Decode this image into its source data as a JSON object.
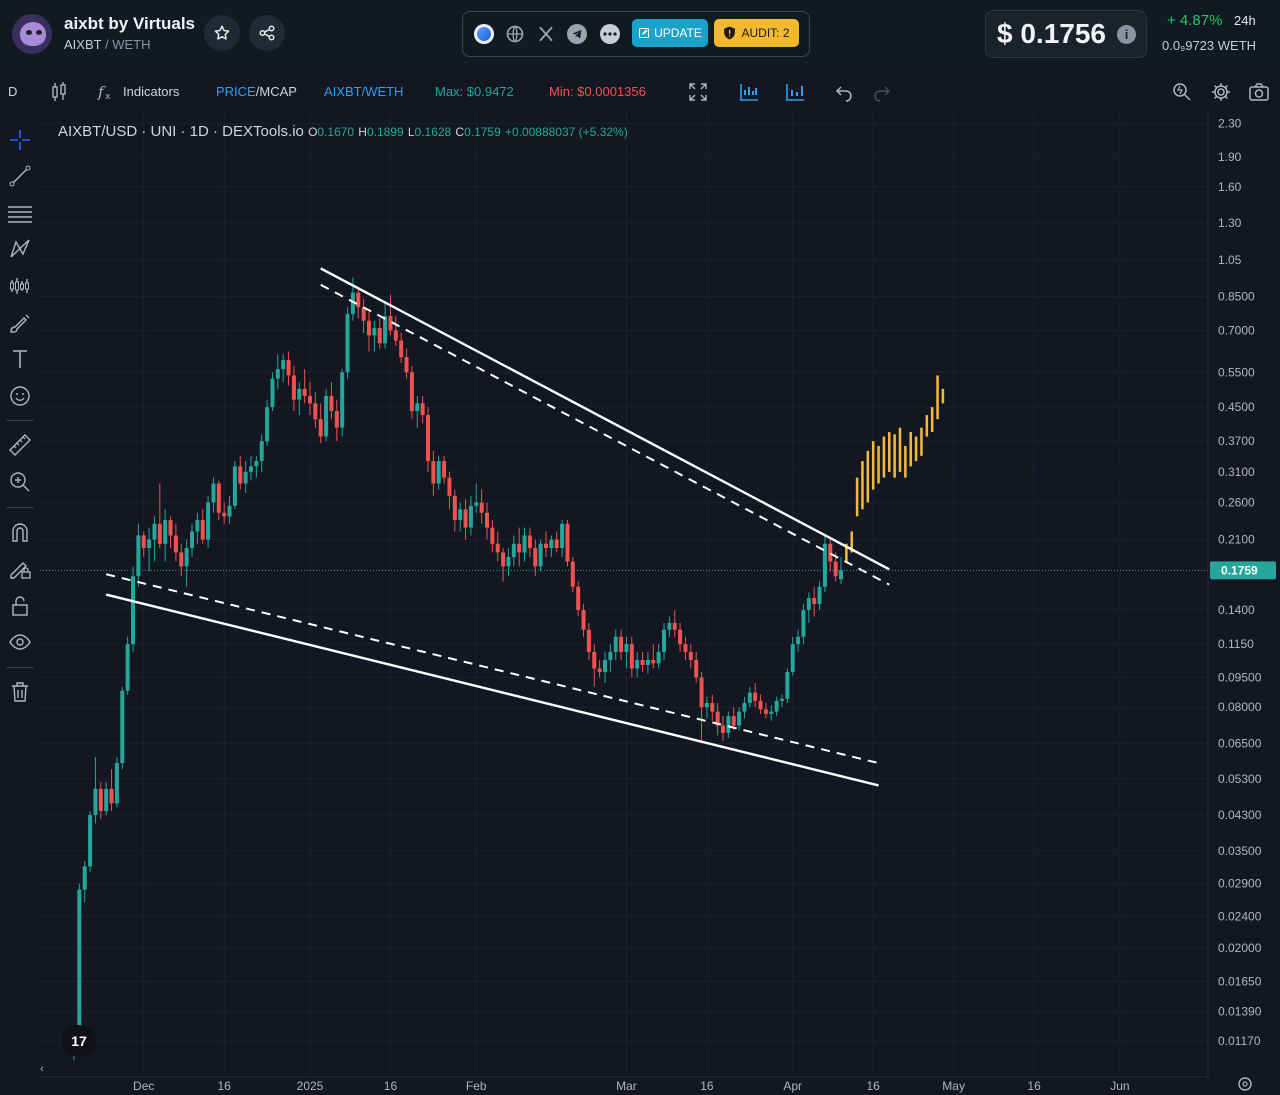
{
  "header": {
    "token_name": "aixbt by Virtuals",
    "token_symbol": "AIXBT",
    "quote_separator": "/",
    "quote_symbol": "WETH",
    "update_label": "UPDATE",
    "audit_label": "AUDIT: 2",
    "price_value": "$ 0.1756",
    "info_label": "i",
    "change": "+ 4.87%",
    "period": "24h",
    "weth_price": "0.0₉9723  WETH"
  },
  "social_icons": [
    "tokenomics-icon",
    "website-icon",
    "x-twitter-icon",
    "telegram-icon",
    "more-icon"
  ],
  "toolbar": {
    "interval": "D",
    "indicators_label": "Indicators",
    "price_label": "PRICE",
    "separator": "/",
    "mcap_label": "MCAP",
    "pair_label": "AIXBT/WETH",
    "max_label": "Max: $0.9472",
    "min_label": "Min: $0.0001356"
  },
  "legend": {
    "symbol": "AIXBT/USD · UNI · 1D · DEXTools.io",
    "o": "0.1670",
    "h": "0.1899",
    "l": "0.1628",
    "c": "0.1759",
    "change": "+0.00888037 (+5.32%)"
  },
  "left_tools": [
    "crosshair-icon",
    "trend-line-icon",
    "fib-icon",
    "pattern-icon",
    "prediction-icon",
    "brush-icon",
    "text-icon",
    "emoji-icon",
    "ruler-icon",
    "zoom-icon",
    "magnet-icon",
    "lock-draw-icon",
    "lock-icon",
    "eye-icon",
    "trash-icon"
  ],
  "colors": {
    "background": "#131722",
    "up": "#26a69a",
    "down": "#ef5350",
    "projection": "#f5b93b",
    "trendline": "#ffffff",
    "current_price_tag": "#26a69a",
    "accent": "#2962ff"
  },
  "chart_data": {
    "type": "candlestick",
    "title": "AIXBT/USD · UNI · 1D · DEXTools.io",
    "y_scale": "log",
    "ylim": [
      0.0105,
      2.35
    ],
    "y_ticks": [
      2.3,
      1.9,
      1.6,
      1.3,
      1.05,
      0.85,
      0.7,
      0.55,
      0.45,
      0.37,
      0.31,
      0.26,
      0.21,
      0.14,
      0.115,
      0.095,
      0.08,
      0.065,
      0.053,
      0.043,
      0.035,
      0.029,
      0.024,
      0.02,
      0.0165,
      0.0139,
      0.0117
    ],
    "y_tick_labels": [
      "2.30",
      "1.90",
      "1.60",
      "1.30",
      "1.05",
      "0.8500",
      "0.7000",
      "0.5500",
      "0.4500",
      "0.3700",
      "0.3100",
      "0.2600",
      "0.2100",
      "0.1400",
      "0.1150",
      "0.09500",
      "0.08000",
      "0.06500",
      "0.05300",
      "0.04300",
      "0.03500",
      "0.02900",
      "0.02400",
      "0.02000",
      "0.01650",
      "0.01390",
      "0.01170"
    ],
    "x_ticks": [
      "Dec",
      "16",
      "2025",
      "16",
      "Feb",
      "Mar",
      "16",
      "Apr",
      "16",
      "May",
      "16",
      "Jun"
    ],
    "x_tick_days": [
      0,
      15,
      31,
      46,
      62,
      90,
      105,
      121,
      136,
      151,
      166,
      182
    ],
    "x_range_days": [
      -13,
      185
    ],
    "current_price": 0.1759,
    "current_price_label": "0.1759",
    "candles": [
      [
        -13,
        0.011,
        0.0125,
        0.0105,
        0.0122
      ],
      [
        -12,
        0.0122,
        0.029,
        0.012,
        0.028
      ],
      [
        -11,
        0.028,
        0.033,
        0.026,
        0.032
      ],
      [
        -10,
        0.032,
        0.044,
        0.031,
        0.043
      ],
      [
        -9,
        0.043,
        0.06,
        0.041,
        0.05
      ],
      [
        -8,
        0.05,
        0.052,
        0.042,
        0.044
      ],
      [
        -7,
        0.044,
        0.052,
        0.043,
        0.05
      ],
      [
        -6,
        0.05,
        0.056,
        0.044,
        0.046
      ],
      [
        -5,
        0.046,
        0.06,
        0.045,
        0.058
      ],
      [
        -4,
        0.058,
        0.09,
        0.056,
        0.088
      ],
      [
        -3,
        0.088,
        0.12,
        0.086,
        0.115
      ],
      [
        -2,
        0.115,
        0.18,
        0.11,
        0.17
      ],
      [
        -1,
        0.17,
        0.23,
        0.16,
        0.215
      ],
      [
        0,
        0.215,
        0.22,
        0.19,
        0.2
      ],
      [
        1,
        0.2,
        0.225,
        0.175,
        0.21
      ],
      [
        2,
        0.21,
        0.24,
        0.185,
        0.23
      ],
      [
        3,
        0.23,
        0.29,
        0.2,
        0.205
      ],
      [
        4,
        0.205,
        0.25,
        0.185,
        0.235
      ],
      [
        5,
        0.235,
        0.24,
        0.2,
        0.215
      ],
      [
        6,
        0.215,
        0.23,
        0.185,
        0.195
      ],
      [
        7,
        0.195,
        0.205,
        0.17,
        0.18
      ],
      [
        8,
        0.18,
        0.21,
        0.16,
        0.2
      ],
      [
        9,
        0.2,
        0.23,
        0.19,
        0.22
      ],
      [
        10,
        0.22,
        0.245,
        0.205,
        0.235
      ],
      [
        11,
        0.235,
        0.25,
        0.205,
        0.21
      ],
      [
        12,
        0.21,
        0.27,
        0.2,
        0.26
      ],
      [
        13,
        0.26,
        0.3,
        0.245,
        0.29
      ],
      [
        14,
        0.29,
        0.295,
        0.235,
        0.245
      ],
      [
        15,
        0.245,
        0.26,
        0.23,
        0.24
      ],
      [
        16,
        0.24,
        0.27,
        0.23,
        0.255
      ],
      [
        17,
        0.255,
        0.33,
        0.25,
        0.32
      ],
      [
        18,
        0.32,
        0.34,
        0.28,
        0.29
      ],
      [
        19,
        0.29,
        0.33,
        0.275,
        0.31
      ],
      [
        20,
        0.31,
        0.34,
        0.295,
        0.32
      ],
      [
        21,
        0.32,
        0.34,
        0.3,
        0.33
      ],
      [
        22,
        0.33,
        0.385,
        0.31,
        0.37
      ],
      [
        23,
        0.37,
        0.47,
        0.36,
        0.45
      ],
      [
        24,
        0.45,
        0.55,
        0.44,
        0.53
      ],
      [
        25,
        0.53,
        0.61,
        0.5,
        0.56
      ],
      [
        26,
        0.56,
        0.61,
        0.52,
        0.59
      ],
      [
        27,
        0.59,
        0.62,
        0.51,
        0.54
      ],
      [
        28,
        0.54,
        0.57,
        0.44,
        0.47
      ],
      [
        29,
        0.47,
        0.52,
        0.43,
        0.5
      ],
      [
        30,
        0.5,
        0.56,
        0.46,
        0.48
      ],
      [
        31,
        0.48,
        0.52,
        0.43,
        0.46
      ],
      [
        32,
        0.46,
        0.49,
        0.4,
        0.42
      ],
      [
        33,
        0.42,
        0.46,
        0.365,
        0.38
      ],
      [
        34,
        0.38,
        0.5,
        0.37,
        0.48
      ],
      [
        35,
        0.48,
        0.52,
        0.42,
        0.44
      ],
      [
        36,
        0.44,
        0.47,
        0.37,
        0.4
      ],
      [
        37,
        0.4,
        0.56,
        0.38,
        0.55
      ],
      [
        38,
        0.55,
        0.8,
        0.53,
        0.77
      ],
      [
        39,
        0.77,
        0.95,
        0.74,
        0.87
      ],
      [
        40,
        0.87,
        0.89,
        0.75,
        0.8
      ],
      [
        41,
        0.8,
        0.84,
        0.69,
        0.74
      ],
      [
        42,
        0.74,
        0.78,
        0.62,
        0.68
      ],
      [
        43,
        0.68,
        0.74,
        0.62,
        0.71
      ],
      [
        44,
        0.71,
        0.75,
        0.63,
        0.65
      ],
      [
        45,
        0.65,
        0.82,
        0.63,
        0.76
      ],
      [
        46,
        0.76,
        0.86,
        0.68,
        0.7
      ],
      [
        47,
        0.7,
        0.76,
        0.64,
        0.66
      ],
      [
        48,
        0.66,
        0.69,
        0.58,
        0.6
      ],
      [
        49,
        0.6,
        0.63,
        0.53,
        0.55
      ],
      [
        50,
        0.55,
        0.57,
        0.42,
        0.44
      ],
      [
        51,
        0.44,
        0.48,
        0.4,
        0.46
      ],
      [
        52,
        0.46,
        0.48,
        0.41,
        0.43
      ],
      [
        53,
        0.43,
        0.45,
        0.31,
        0.33
      ],
      [
        54,
        0.33,
        0.35,
        0.27,
        0.29
      ],
      [
        55,
        0.29,
        0.34,
        0.28,
        0.33
      ],
      [
        56,
        0.33,
        0.34,
        0.29,
        0.3
      ],
      [
        57,
        0.3,
        0.31,
        0.25,
        0.27
      ],
      [
        58,
        0.27,
        0.28,
        0.22,
        0.235
      ],
      [
        59,
        0.235,
        0.26,
        0.22,
        0.25
      ],
      [
        60,
        0.25,
        0.265,
        0.21,
        0.225
      ],
      [
        61,
        0.225,
        0.27,
        0.215,
        0.255
      ],
      [
        62,
        0.255,
        0.29,
        0.245,
        0.26
      ],
      [
        63,
        0.26,
        0.28,
        0.23,
        0.245
      ],
      [
        64,
        0.245,
        0.26,
        0.21,
        0.225
      ],
      [
        65,
        0.225,
        0.235,
        0.195,
        0.205
      ],
      [
        66,
        0.205,
        0.22,
        0.185,
        0.195
      ],
      [
        67,
        0.195,
        0.2,
        0.165,
        0.18
      ],
      [
        68,
        0.18,
        0.2,
        0.17,
        0.19
      ],
      [
        69,
        0.19,
        0.215,
        0.18,
        0.205
      ],
      [
        70,
        0.205,
        0.225,
        0.18,
        0.195
      ],
      [
        71,
        0.195,
        0.225,
        0.185,
        0.215
      ],
      [
        72,
        0.215,
        0.225,
        0.19,
        0.2
      ],
      [
        73,
        0.2,
        0.21,
        0.17,
        0.18
      ],
      [
        74,
        0.18,
        0.21,
        0.175,
        0.205
      ],
      [
        75,
        0.205,
        0.22,
        0.19,
        0.2
      ],
      [
        76,
        0.2,
        0.215,
        0.19,
        0.21
      ],
      [
        77,
        0.21,
        0.22,
        0.195,
        0.2
      ],
      [
        78,
        0.2,
        0.235,
        0.19,
        0.23
      ],
      [
        79,
        0.23,
        0.235,
        0.18,
        0.185
      ],
      [
        80,
        0.185,
        0.19,
        0.155,
        0.16
      ],
      [
        81,
        0.16,
        0.165,
        0.135,
        0.14
      ],
      [
        82,
        0.14,
        0.145,
        0.12,
        0.125
      ],
      [
        83,
        0.125,
        0.13,
        0.105,
        0.11
      ],
      [
        84,
        0.11,
        0.115,
        0.09,
        0.1
      ],
      [
        85,
        0.1,
        0.105,
        0.095,
        0.098
      ],
      [
        86,
        0.098,
        0.11,
        0.092,
        0.105
      ],
      [
        87,
        0.105,
        0.115,
        0.098,
        0.11
      ],
      [
        88,
        0.11,
        0.125,
        0.105,
        0.12
      ],
      [
        89,
        0.12,
        0.125,
        0.105,
        0.11
      ],
      [
        90,
        0.11,
        0.12,
        0.1,
        0.115
      ],
      [
        91,
        0.115,
        0.12,
        0.095,
        0.1
      ],
      [
        92,
        0.1,
        0.11,
        0.095,
        0.105
      ],
      [
        93,
        0.105,
        0.11,
        0.098,
        0.102
      ],
      [
        94,
        0.102,
        0.11,
        0.097,
        0.105
      ],
      [
        95,
        0.105,
        0.115,
        0.1,
        0.103
      ],
      [
        96,
        0.103,
        0.115,
        0.1,
        0.11
      ],
      [
        97,
        0.11,
        0.13,
        0.105,
        0.125
      ],
      [
        98,
        0.125,
        0.135,
        0.12,
        0.13
      ],
      [
        99,
        0.13,
        0.14,
        0.12,
        0.125
      ],
      [
        100,
        0.125,
        0.13,
        0.11,
        0.115
      ],
      [
        101,
        0.115,
        0.12,
        0.105,
        0.11
      ],
      [
        102,
        0.11,
        0.115,
        0.1,
        0.105
      ],
      [
        103,
        0.105,
        0.11,
        0.092,
        0.095
      ],
      [
        104,
        0.095,
        0.098,
        0.065,
        0.08
      ],
      [
        105,
        0.08,
        0.085,
        0.075,
        0.082
      ],
      [
        106,
        0.082,
        0.086,
        0.074,
        0.078
      ],
      [
        107,
        0.078,
        0.082,
        0.068,
        0.072
      ],
      [
        108,
        0.072,
        0.076,
        0.066,
        0.069
      ],
      [
        109,
        0.069,
        0.078,
        0.067,
        0.076
      ],
      [
        110,
        0.076,
        0.08,
        0.07,
        0.072
      ],
      [
        111,
        0.072,
        0.08,
        0.07,
        0.078
      ],
      [
        112,
        0.078,
        0.085,
        0.075,
        0.082
      ],
      [
        113,
        0.082,
        0.09,
        0.08,
        0.087
      ],
      [
        114,
        0.087,
        0.092,
        0.08,
        0.083
      ],
      [
        115,
        0.083,
        0.086,
        0.077,
        0.079
      ],
      [
        116,
        0.079,
        0.082,
        0.075,
        0.077
      ],
      [
        117,
        0.077,
        0.081,
        0.074,
        0.078
      ],
      [
        118,
        0.078,
        0.085,
        0.076,
        0.083
      ],
      [
        119,
        0.083,
        0.086,
        0.08,
        0.084
      ],
      [
        120,
        0.084,
        0.1,
        0.082,
        0.098
      ],
      [
        121,
        0.098,
        0.12,
        0.096,
        0.115
      ],
      [
        122,
        0.115,
        0.125,
        0.11,
        0.12
      ],
      [
        123,
        0.12,
        0.145,
        0.115,
        0.14
      ],
      [
        124,
        0.14,
        0.155,
        0.13,
        0.15
      ],
      [
        125,
        0.15,
        0.16,
        0.135,
        0.145
      ],
      [
        126,
        0.145,
        0.165,
        0.14,
        0.16
      ],
      [
        127,
        0.16,
        0.215,
        0.155,
        0.205
      ],
      [
        128,
        0.205,
        0.21,
        0.175,
        0.185
      ],
      [
        129,
        0.185,
        0.195,
        0.165,
        0.17
      ],
      [
        130,
        0.167,
        0.1899,
        0.1628,
        0.1759
      ]
    ],
    "projection": [
      [
        131,
        0.185,
        0.205
      ],
      [
        132,
        0.195,
        0.22
      ],
      [
        133,
        0.24,
        0.3
      ],
      [
        134,
        0.25,
        0.33
      ],
      [
        135,
        0.26,
        0.35
      ],
      [
        136,
        0.28,
        0.37
      ],
      [
        137,
        0.29,
        0.36
      ],
      [
        138,
        0.3,
        0.38
      ],
      [
        139,
        0.31,
        0.39
      ],
      [
        140,
        0.3,
        0.385
      ],
      [
        141,
        0.31,
        0.4
      ],
      [
        142,
        0.3,
        0.36
      ],
      [
        143,
        0.32,
        0.39
      ],
      [
        144,
        0.33,
        0.38
      ],
      [
        145,
        0.34,
        0.4
      ],
      [
        146,
        0.38,
        0.43
      ],
      [
        147,
        0.39,
        0.45
      ],
      [
        148,
        0.42,
        0.54
      ],
      [
        149,
        0.46,
        0.5
      ]
    ],
    "trendlines": [
      {
        "style": "solid",
        "points": [
          [
            33,
            1.0
          ],
          [
            139,
            0.177
          ]
        ]
      },
      {
        "style": "dashed",
        "points": [
          [
            33,
            0.91
          ],
          [
            139,
            0.162
          ]
        ]
      },
      {
        "style": "solid",
        "points": [
          [
            -7,
            0.153
          ],
          [
            137,
            0.051
          ]
        ]
      },
      {
        "style": "dashed",
        "points": [
          [
            -7,
            0.172
          ],
          [
            137,
            0.058
          ]
        ]
      }
    ]
  }
}
